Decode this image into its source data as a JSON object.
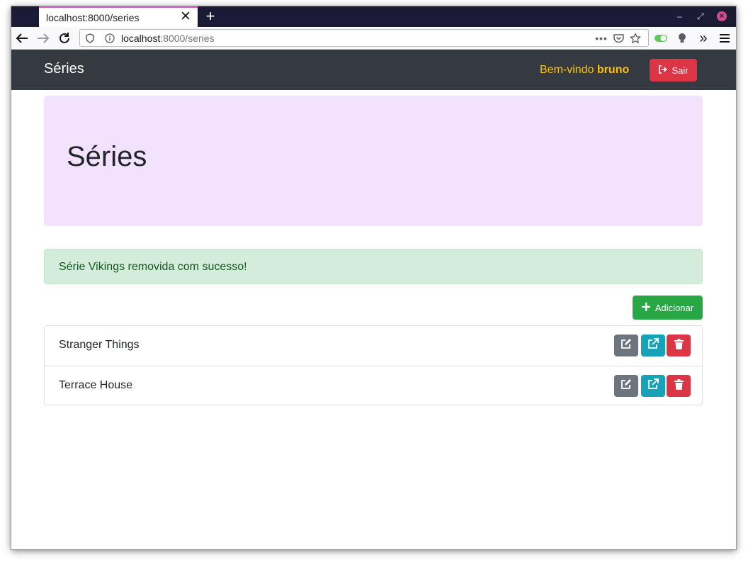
{
  "browser": {
    "tab_title": "localhost:8000/series",
    "url_host": "localhost",
    "url_rest": ":8000/series"
  },
  "navbar": {
    "brand": "Séries",
    "welcome_prefix": "Bem-vindo ",
    "username": "bruno",
    "logout_label": "Sair"
  },
  "jumbotron": {
    "title": "Séries"
  },
  "alert": {
    "message": "Série Vikings removida com sucesso!"
  },
  "actions": {
    "add_label": "Adicionar"
  },
  "series": [
    {
      "name": "Stranger Things"
    },
    {
      "name": "Terrace House"
    }
  ],
  "colors": {
    "navbar": "#343a40",
    "welcome": "#ffc107",
    "danger": "#dc3545",
    "success": "#28a745",
    "info": "#17a2b8",
    "secondary": "#6c757d",
    "jumbotron": "#f3e2fd",
    "alert_bg": "#d4edda"
  },
  "icons": {
    "logout": "sign-out-icon",
    "add": "plus-icon",
    "edit": "edit-icon",
    "open": "external-link-icon",
    "delete": "trash-icon"
  }
}
